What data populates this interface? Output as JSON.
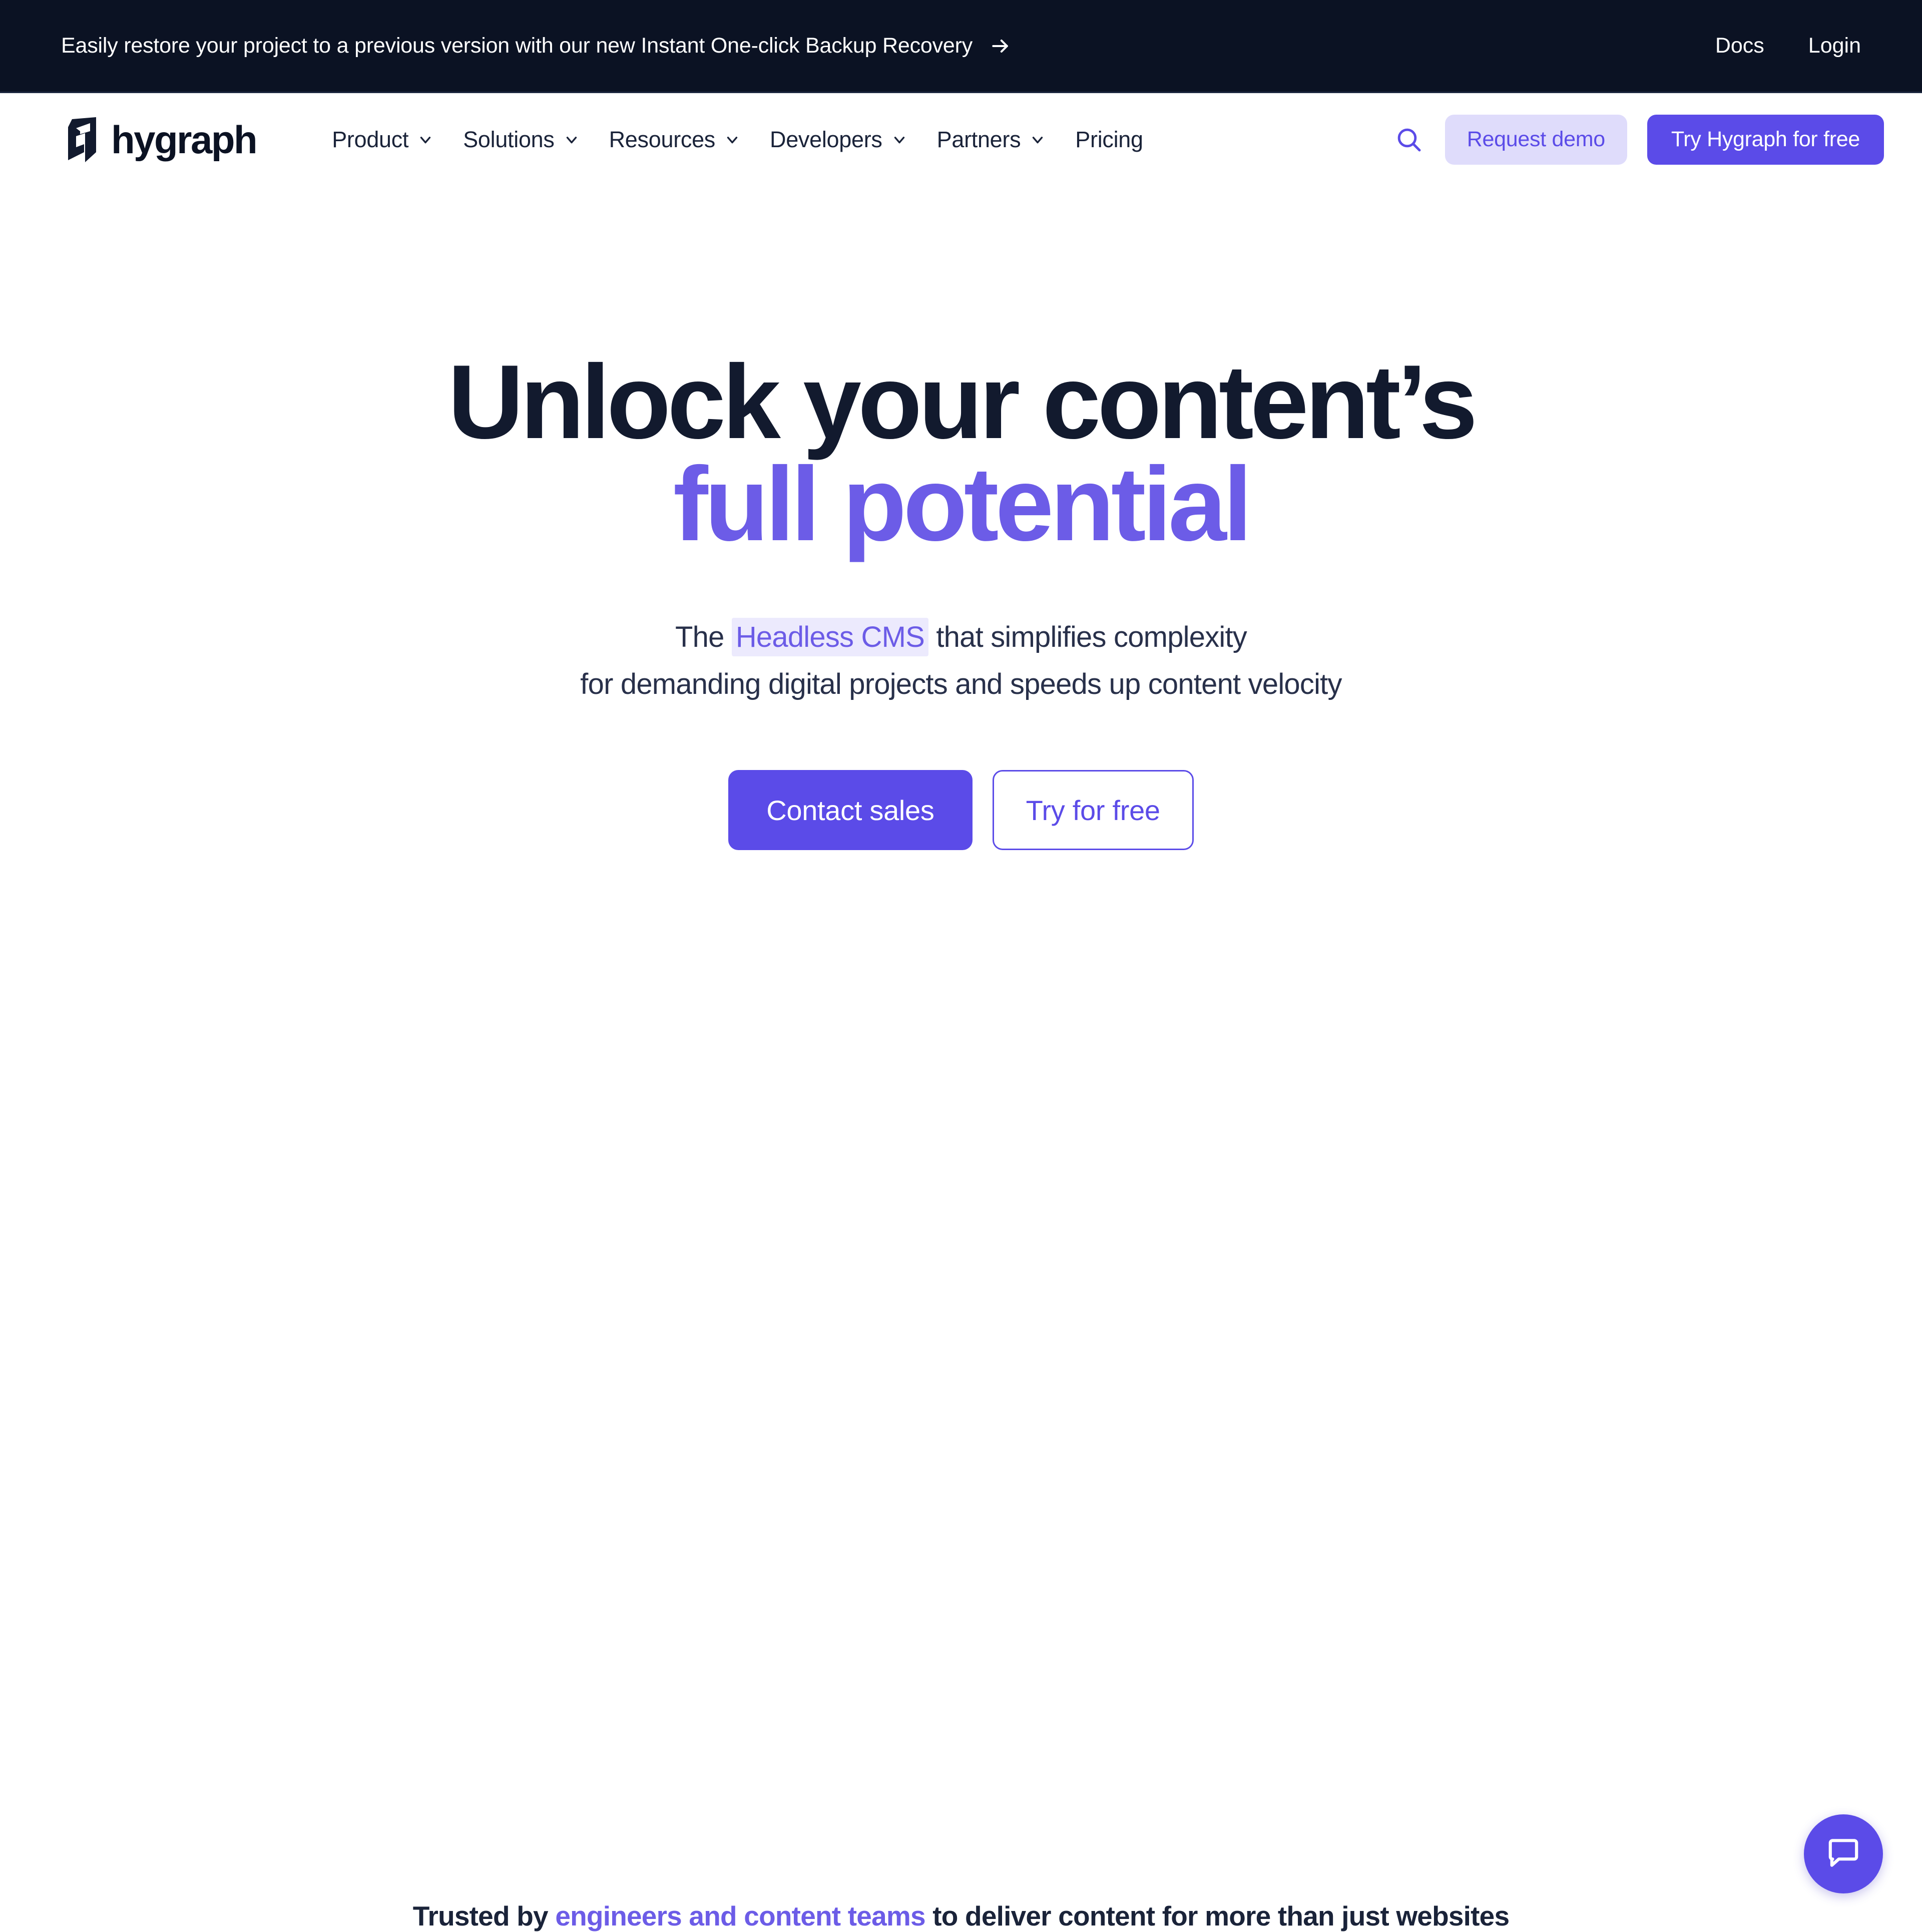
{
  "banner": {
    "message": "Easily restore your project to a previous version with our new Instant One-click Backup Recovery",
    "arrow_icon": "arrow-right-icon",
    "links": [
      {
        "label": "Docs"
      },
      {
        "label": "Login"
      }
    ]
  },
  "nav": {
    "brand": {
      "name": "hygraph",
      "logo_icon": "hygraph-logo-icon"
    },
    "items": [
      {
        "label": "Product",
        "has_dropdown": true
      },
      {
        "label": "Solutions",
        "has_dropdown": true
      },
      {
        "label": "Resources",
        "has_dropdown": true
      },
      {
        "label": "Developers",
        "has_dropdown": true
      },
      {
        "label": "Partners",
        "has_dropdown": true
      },
      {
        "label": "Pricing",
        "has_dropdown": false
      }
    ],
    "search_icon": "search-icon",
    "request_demo_label": "Request demo",
    "try_free_label": "Try Hygraph for free"
  },
  "hero": {
    "title_line1": "Unlock your content’s",
    "title_line2": "full potential",
    "sub_line1_pre": "The ",
    "sub_line1_highlight": "Headless CMS",
    "sub_line1_post": " that simplifies complexity",
    "sub_line2": "for demanding digital projects and speeds up content velocity",
    "cta_primary": "Contact sales",
    "cta_secondary": "Try for free"
  },
  "trusted": {
    "prefix": "Trusted by ",
    "accent": "engineers and content teams",
    "suffix": " to deliver content for more than just websites"
  },
  "chat": {
    "icon": "chat-bubble-icon"
  },
  "colors": {
    "banner_bg": "#0B1223",
    "brand_purple": "#5B4BE8",
    "accent_purple": "#6C5CE7",
    "purple_soft_bg": "#DFDCFB",
    "highlight_bg": "#ECEAFD",
    "ink": "#121A2E",
    "body_text": "#28304A",
    "page_bg": "#FFFFFF"
  }
}
